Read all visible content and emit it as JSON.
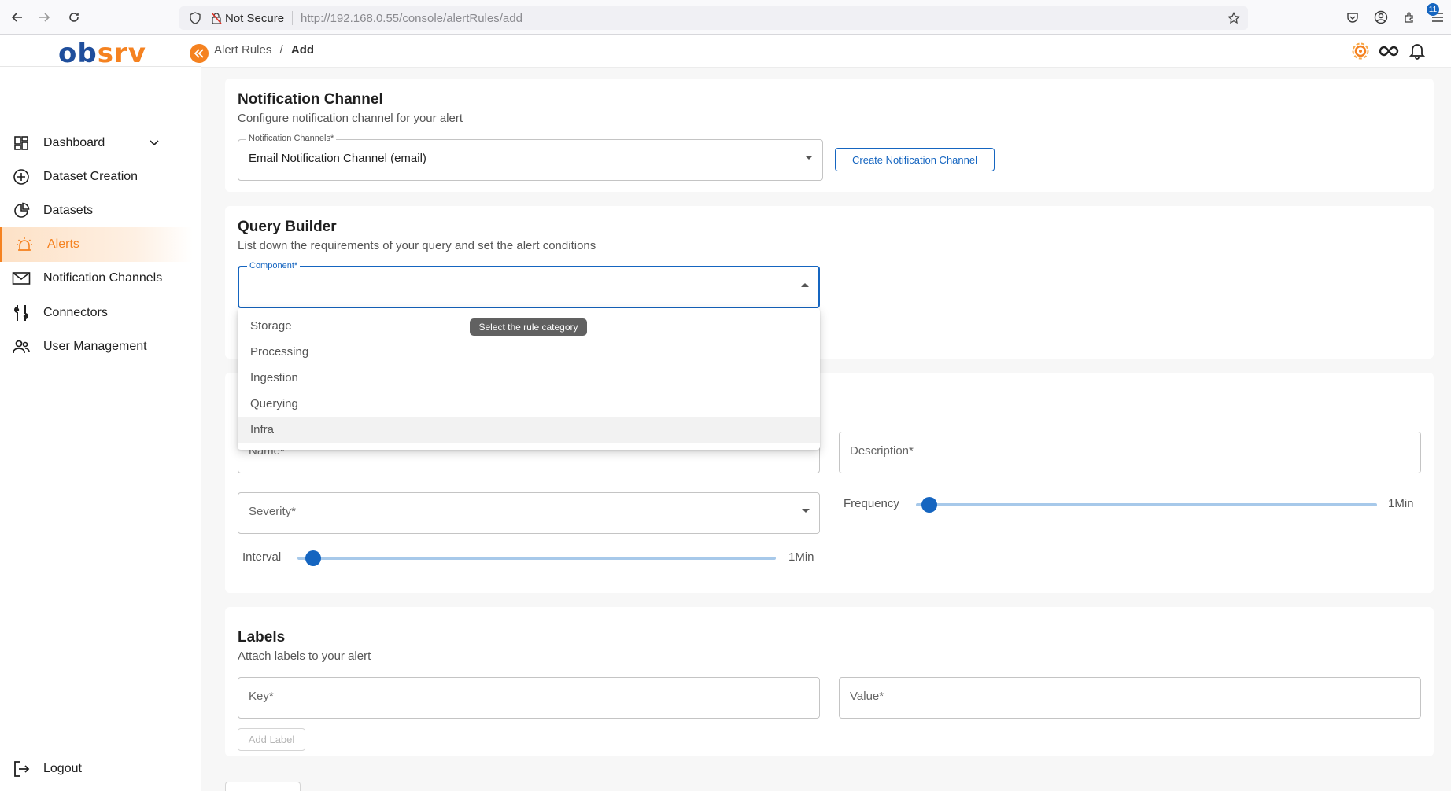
{
  "browser": {
    "not_secure": "Not Secure",
    "url_host": "http://192.168.0.55",
    "url_path": "/console/alertRules/add"
  },
  "brand": {
    "logo_ob": "ob",
    "logo_srv": "srv",
    "accent": "#f58220",
    "primary": "#1565c0"
  },
  "sidebar": {
    "items": [
      {
        "label": "Dashboard",
        "icon": "dashboard-grid-icon"
      },
      {
        "label": "Dataset Creation",
        "icon": "plus-circle-icon"
      },
      {
        "label": "Datasets",
        "icon": "datasets-icon"
      },
      {
        "label": "Alerts",
        "icon": "alarm-icon",
        "active": true
      },
      {
        "label": "Notification Channels",
        "icon": "mail-icon"
      },
      {
        "label": "Connectors",
        "icon": "connectors-icon"
      },
      {
        "label": "User Management",
        "icon": "users-icon"
      }
    ],
    "logout": "Logout"
  },
  "header": {
    "breadcrumb_root": "Alert Rules",
    "breadcrumb_sep": "/",
    "breadcrumb_current": "Add",
    "notification_count": "11"
  },
  "notification_channel": {
    "title": "Notification Channel",
    "subtitle": "Configure notification channel for your alert",
    "field_label": "Notification Channels*",
    "field_value": "Email Notification Channel (email)",
    "create_button": "Create Notification Channel"
  },
  "query_builder": {
    "title": "Query Builder",
    "subtitle": "List down the requirements of your query and set the alert conditions",
    "component_label": "Component*",
    "tooltip": "Select the rule category",
    "options": [
      "Storage",
      "Processing",
      "Ingestion",
      "Querying",
      "Infra"
    ]
  },
  "rule": {
    "name_placeholder": "Name*",
    "description_placeholder": "Description*",
    "severity_placeholder": "Severity*",
    "frequency_label": "Frequency",
    "frequency_value": "1Min",
    "interval_label": "Interval",
    "interval_value": "1Min"
  },
  "labels": {
    "title": "Labels",
    "subtitle": "Attach labels to your alert",
    "key_placeholder": "Key*",
    "value_placeholder": "Value*",
    "add_button": "Add Label"
  }
}
